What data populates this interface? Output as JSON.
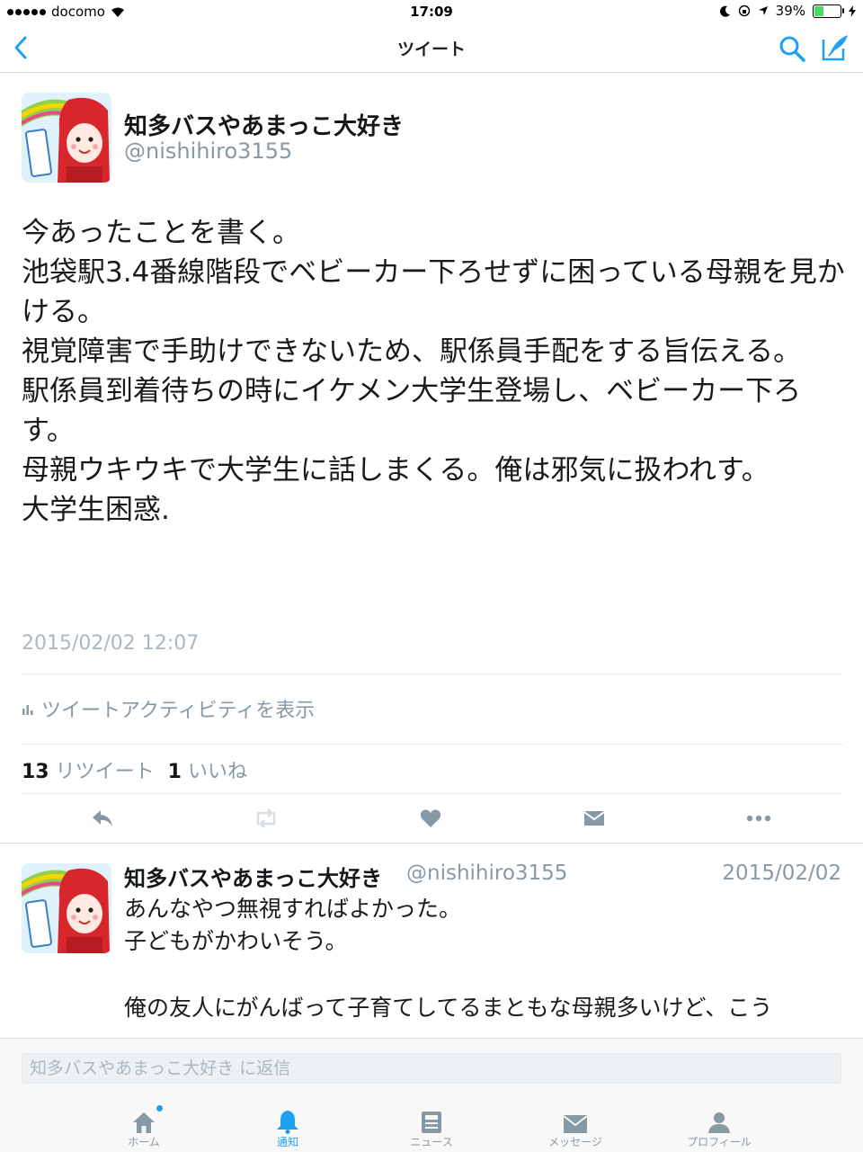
{
  "status_bar": {
    "carrier": "docomo",
    "time": "17:09",
    "battery": "39%",
    "battery_level": 0.39
  },
  "nav": {
    "title": "ツイート",
    "back_icon": "chevron-left-icon",
    "search_icon": "search-icon",
    "compose_icon": "compose-icon"
  },
  "tweet": {
    "display_name": "知多バスやあまっこ大好き",
    "handle": "@nishihiro3155",
    "lines": [
      "今あったことを書く。",
      "池袋駅3.4番線階段でベビーカー下ろせずに困っている母親を見かける。",
      "視覚障害で手助けできないため、駅係員手配をする旨伝える。",
      "駅係員到着待ちの時にイケメン大学生登場し、ベビーカー下ろす。",
      "母親ウキウキで大学生に話しまくる。俺は邪気に扱われす。",
      "大学生困惑."
    ],
    "timestamp": "2015/02/02 12:07",
    "activity_label": "ツイートアクティビティを表示",
    "retweet_count": "13",
    "retweet_label": "リツイート",
    "like_count": "1",
    "like_label": "いいね"
  },
  "reply": {
    "display_name": "知多バスやあまっこ大好き",
    "handle": "@nishihiro3155",
    "date": "2015/02/02",
    "line1": "あんなやつ無視すればよかった。",
    "line2": "子どもがかわいそう。",
    "line3": "俺の友人にがんばって子育てしてるまともな母親多いけど、こう"
  },
  "reply_bar": {
    "placeholder": "知多バスやあまっこ大好き に返信"
  },
  "tabs": [
    {
      "label": "ホーム",
      "icon": "home-icon"
    },
    {
      "label": "通知",
      "icon": "bell-icon"
    },
    {
      "label": "ニュース",
      "icon": "news-icon"
    },
    {
      "label": "メッセージ",
      "icon": "envelope-icon"
    },
    {
      "label": "プロフィール",
      "icon": "person-icon"
    }
  ],
  "colors": {
    "accent": "#1da1f2",
    "muted": "#8899a6"
  }
}
